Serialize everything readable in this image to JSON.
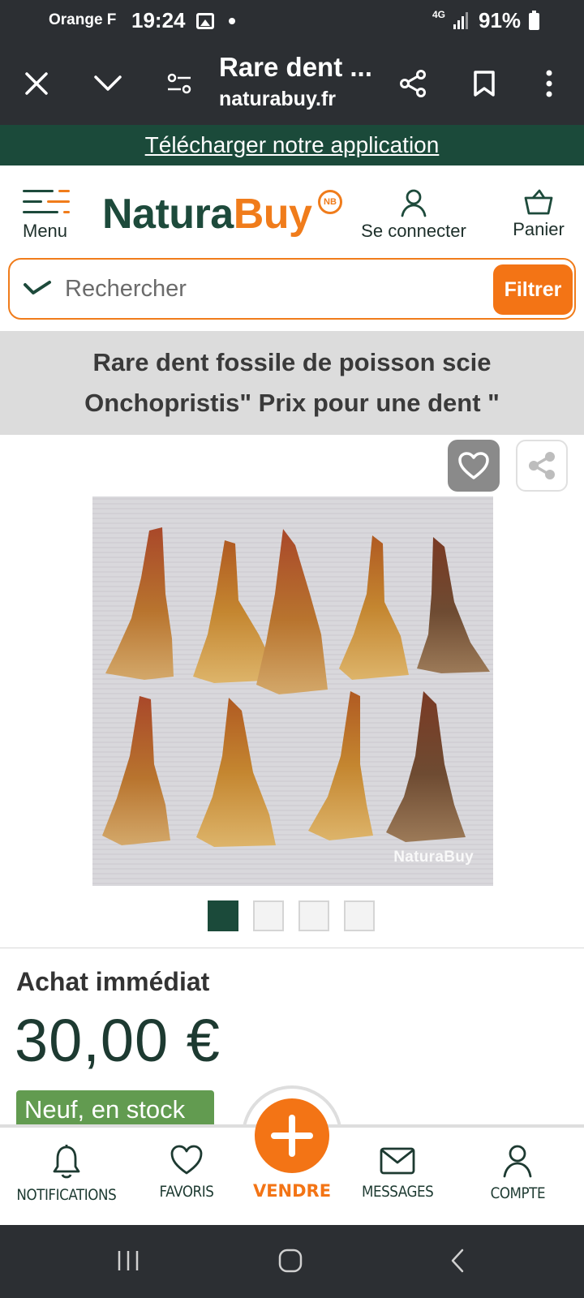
{
  "status_bar": {
    "carrier": "Orange F",
    "time": "19:24",
    "network": "4G",
    "battery": "91%"
  },
  "browser": {
    "page_title": "Rare dent ...",
    "url": "naturabuy.fr",
    "icons": [
      "close-icon",
      "chevron-down-icon",
      "site-settings-icon",
      "share-icon",
      "bookmark-icon",
      "more-vert-icon"
    ]
  },
  "app_banner": {
    "text": "Télécharger notre application"
  },
  "header": {
    "menu_label": "Menu",
    "logo_natura": "Natura",
    "logo_buy": "Buy",
    "logo_badge": "NB",
    "login_label": "Se connecter",
    "cart_label": "Panier"
  },
  "search": {
    "placeholder": "Rechercher",
    "filter_label": "Filtrer"
  },
  "product": {
    "title": "Rare dent fossile de poisson scie Onchopristis\" Prix pour une dent \"",
    "image_watermark": "NaturaBuy",
    "thumbnails_count": 4,
    "active_thumbnail": 1,
    "purchase_type": "Achat immédiat",
    "price": "30,00 €",
    "stock_status": "Neuf, en stock"
  },
  "bottom_nav": {
    "notifications": "NOTIFICATIONS",
    "favorites": "FAVORIS",
    "sell": "VENDRE",
    "messages": "MESSAGES",
    "account": "COMPTE"
  },
  "colors": {
    "brand_green": "#1b4a3a",
    "brand_orange": "#f37415",
    "stock_green": "#629b50",
    "title_band": "#dcdcdc",
    "system_bar": "#2c2f33"
  }
}
